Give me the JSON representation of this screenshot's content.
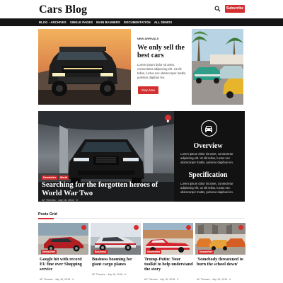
{
  "header": {
    "logo": "Cars Blog",
    "subscribe_label": "Subscribe"
  },
  "nav": {
    "items": [
      "BLOG - ARCHIVES",
      "SINGLE PAGES",
      "MAIN BANNERS",
      "DOCUMENTATION",
      "ALL DEMOS"
    ]
  },
  "feature": {
    "kicker": "NEW ARRIVALS",
    "title": "We only sell the best cars",
    "excerpt": "Lorem ipsum dolor sit amet, consectetur adipiscing elit. Ut elit tellus, luctus nec ullamcorper mattis, pulvinar dapibus leo.",
    "button_label": "Shop Now"
  },
  "banner": {
    "tags": [
      "Newsletter",
      "World"
    ],
    "headline": "Searching for the forgotten heroes of World War Two",
    "meta": "AF Themes  ·  July 16, 2018  ·  0",
    "overview_heading": "Overview",
    "overview_text": "Lorem ipsum dolor sit amet, consectetur adipiscing elit. Ut elit tellus, luctus nec ullamcorper mattis, pulvinar dapibus leo.",
    "spec_heading": "Specification",
    "spec_text": "Lorem ipsum dolor sit amet, consectetur adipiscing elit. Ut elit tellus, luctus nec ullamcorper mattis, pulvinar dapibus leo."
  },
  "posts_grid": {
    "title": "Posts Grid",
    "cards": [
      {
        "category": "Newsletter",
        "title": "Google hit with record EU fine over Shopping service",
        "meta": "AF Themes  ·  July 16, 2018  ·  0"
      },
      {
        "category": "Business",
        "title": "Business booming for giant cargo planes",
        "meta": "AF Themes  ·  July 16, 2018  ·  0"
      },
      {
        "category": "Newsletter",
        "title": "Trump-Putin: Your toolkit to help understand the story",
        "meta": "AF Themes  ·  July 16, 2018  ·  0"
      },
      {
        "category": "Newsletter",
        "title": "'Somebody threatened to burn the school down'",
        "meta": "AF Themes  ·  July 16, 2018  ·  0"
      }
    ]
  },
  "colors": {
    "accent": "#d32f2f",
    "nav_bg": "#141414",
    "banner_bg": "#121212"
  }
}
